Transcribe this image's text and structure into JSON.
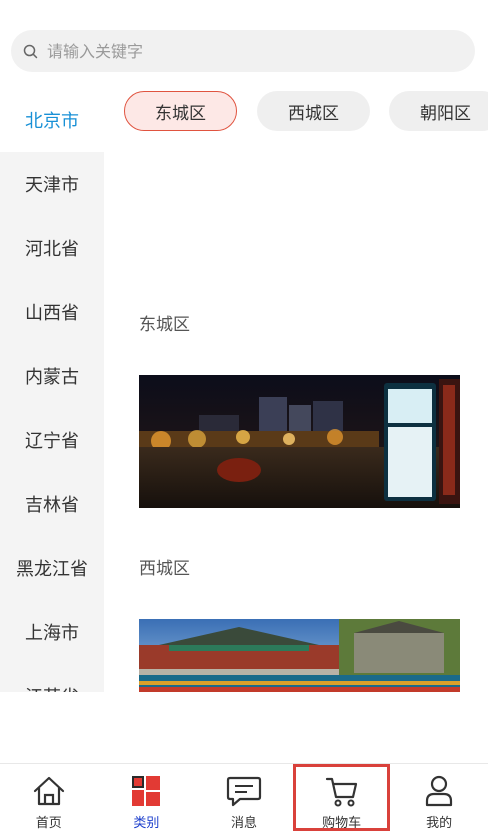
{
  "search": {
    "placeholder": "请输入关键字"
  },
  "sidebar": {
    "items": [
      {
        "label": "北京市"
      },
      {
        "label": "天津市"
      },
      {
        "label": "河北省"
      },
      {
        "label": "山西省"
      },
      {
        "label": "内蒙古"
      },
      {
        "label": "辽宁省"
      },
      {
        "label": "吉林省"
      },
      {
        "label": "黑龙江省"
      },
      {
        "label": "上海市"
      },
      {
        "label": "江苏省"
      }
    ],
    "active_index": 0
  },
  "tabs": [
    {
      "label": "东城区"
    },
    {
      "label": "西城区"
    },
    {
      "label": "朝阳区"
    }
  ],
  "sections": [
    {
      "title": "东城区"
    },
    {
      "title": "西城区"
    }
  ],
  "bottom_nav": [
    {
      "label": "首页",
      "icon": "home-icon"
    },
    {
      "label": "类别",
      "icon": "category-icon"
    },
    {
      "label": "消息",
      "icon": "message-icon"
    },
    {
      "label": "购物车",
      "icon": "cart-icon"
    },
    {
      "label": "我的",
      "icon": "profile-icon"
    }
  ],
  "colors": {
    "accent_blue": "#1890d6",
    "active_tab_border": "#e0533f",
    "highlight_red": "#d9413b",
    "category_red": "#e23a34",
    "nav_active_label": "#1d3fcc"
  }
}
